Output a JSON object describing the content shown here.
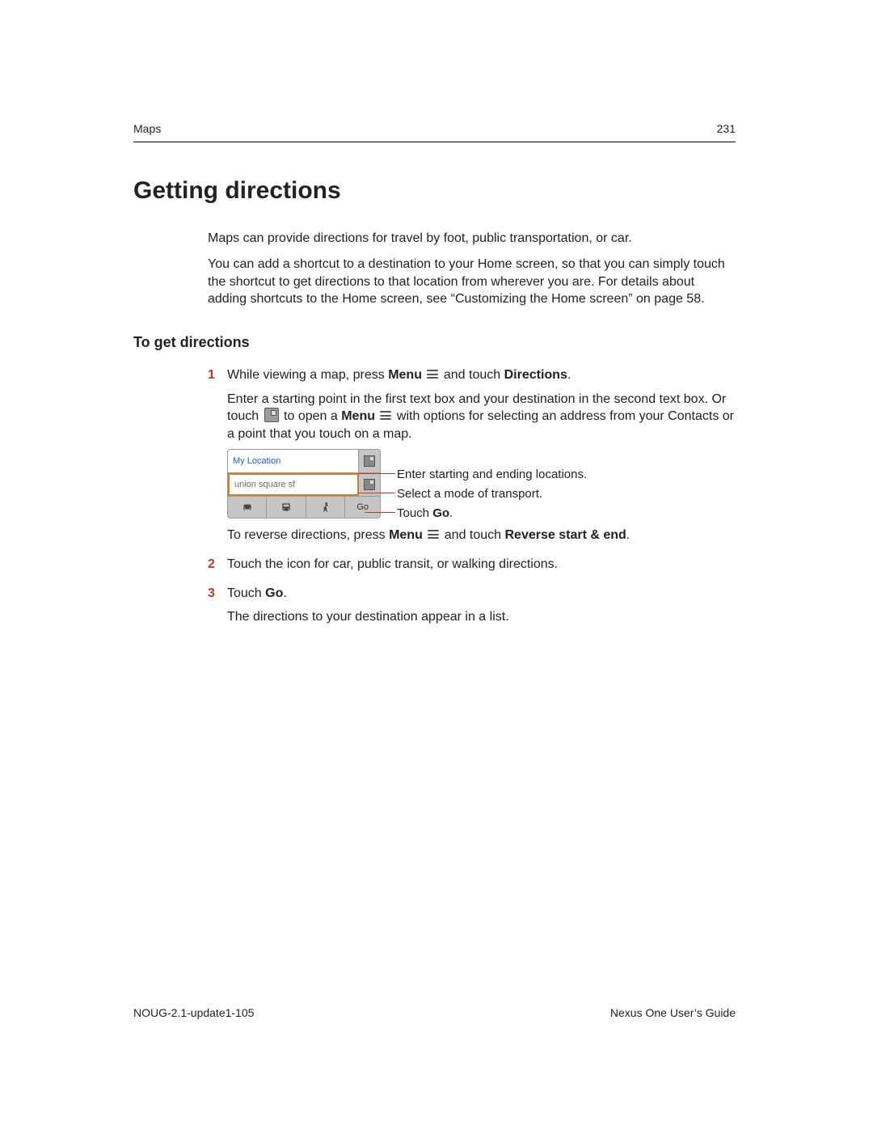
{
  "header": {
    "section": "Maps",
    "page": "231"
  },
  "title": "Getting directions",
  "intro": {
    "p1": "Maps can provide directions for travel by foot, public transportation, or car.",
    "p2": "You can add a shortcut to a destination to your Home screen, so that you can simply touch the shortcut to get directions to that location from wherever you are. For details about adding shortcuts to the Home screen, see “Customizing the Home screen” on page 58."
  },
  "subtitle": "To get directions",
  "steps": {
    "s1": {
      "num": "1",
      "line1_a": "While viewing a map, press ",
      "line1_menu": "Menu",
      "line1_b": " and touch ",
      "line1_directions": "Directions",
      "line1_c": ".",
      "para2_a": "Enter a starting point in the first text box and your destination in the second text box. Or touch ",
      "para2_b": " to open a ",
      "para2_menu": "Menu",
      "para2_c": " with options for selecting an address from your Contacts or a point that you touch on a map.",
      "reverse_a": "To reverse directions, press ",
      "reverse_menu": "Menu",
      "reverse_b": " and touch ",
      "reverse_bold": "Reverse start & end",
      "reverse_c": "."
    },
    "s2": {
      "num": "2",
      "text": "Touch the icon for car, public transit, or walking directions."
    },
    "s3": {
      "num": "3",
      "text_a": "Touch ",
      "text_go": "Go",
      "text_b": ".",
      "after": "The directions to your destination appear in a list."
    }
  },
  "figure": {
    "start_field": "My Location",
    "end_field": "union square sf",
    "go_label": "Go",
    "callout1": "Enter starting and ending locations.",
    "callout2": "Select a mode of transport.",
    "callout3_a": "Touch ",
    "callout3_go": "Go",
    "callout3_b": "."
  },
  "footer": {
    "left": "NOUG-2.1-update1-105",
    "right": "Nexus One User’s Guide"
  }
}
